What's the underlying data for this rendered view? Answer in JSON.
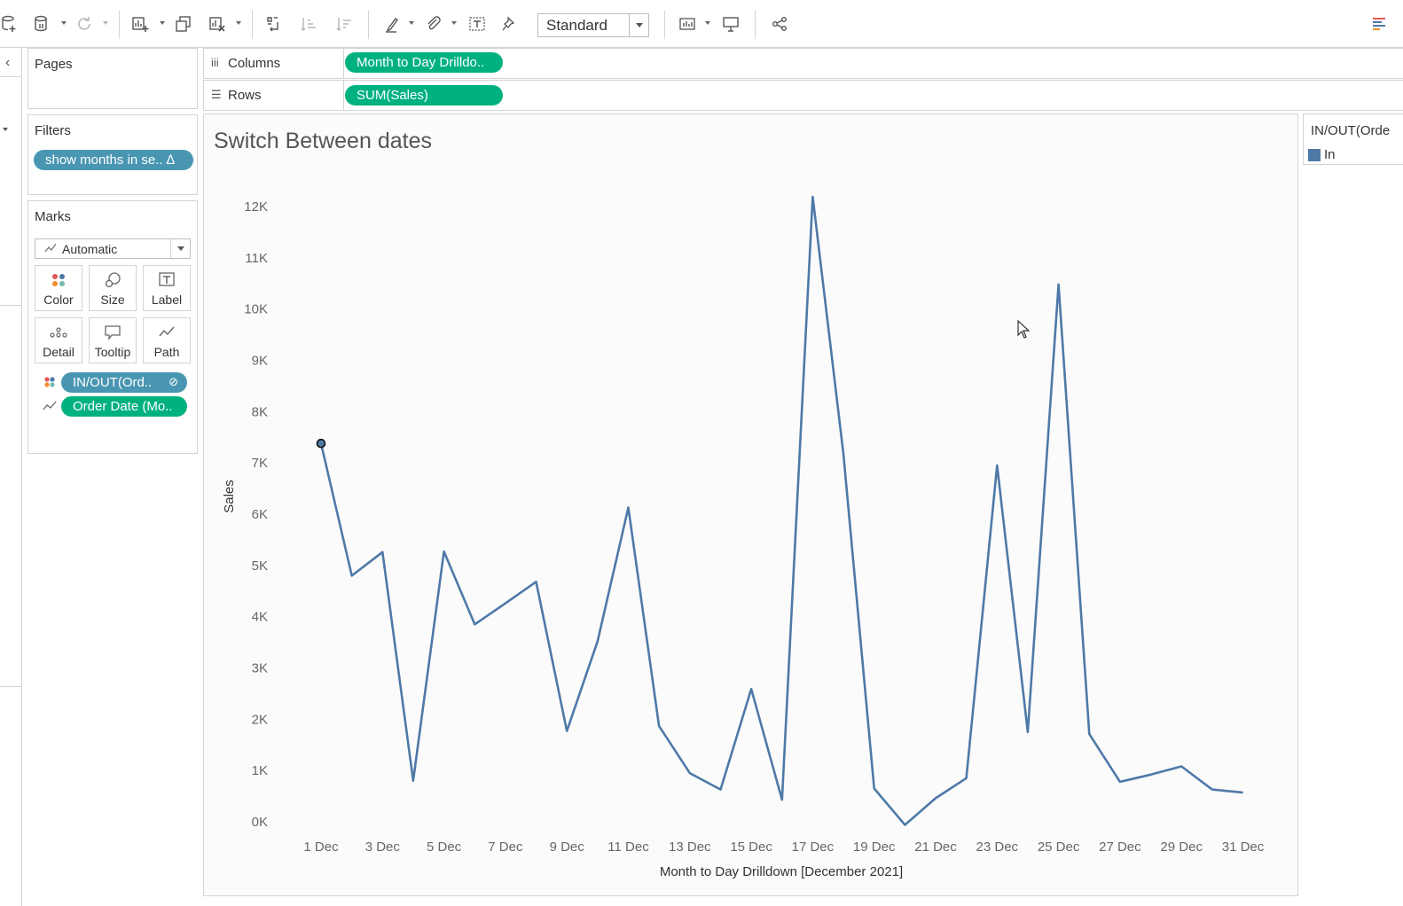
{
  "toolbar": {
    "view_size_select": "Standard"
  },
  "cards": {
    "pages": {
      "title": "Pages"
    },
    "filters": {
      "title": "Filters",
      "pills": [
        {
          "label": "show months in se.. ∆"
        }
      ]
    },
    "marks": {
      "title": "Marks",
      "mark_type": "Automatic",
      "buttons": [
        {
          "label": "Color",
          "icon": "color-dots-icon"
        },
        {
          "label": "Size",
          "icon": "size-icon"
        },
        {
          "label": "Label",
          "icon": "label-icon"
        },
        {
          "label": "Detail",
          "icon": "detail-icon"
        },
        {
          "label": "Tooltip",
          "icon": "tooltip-icon"
        },
        {
          "label": "Path",
          "icon": "path-icon"
        }
      ],
      "pills": [
        {
          "label": "IN/OUT(Ord..",
          "icon": "color-dots-icon"
        },
        {
          "label": "Order Date (Mo..",
          "icon": "path-icon"
        }
      ]
    }
  },
  "shelves": {
    "columns": {
      "label": "Columns",
      "pill": "Month to Day Drilldo.."
    },
    "rows": {
      "label": "Rows",
      "pill": "SUM(Sales)"
    }
  },
  "legend": {
    "title": "IN/OUT(Orde",
    "items": [
      {
        "label": "In",
        "color": "#4e79a7"
      }
    ]
  },
  "chart_data": {
    "type": "line",
    "title": "Switch Between dates",
    "xlabel": "Month to Day Drilldown [December 2021]",
    "ylabel": "Sales",
    "x_tick_labels": [
      "1 Dec",
      "3 Dec",
      "5 Dec",
      "7 Dec",
      "9 Dec",
      "11 Dec",
      "13 Dec",
      "15 Dec",
      "17 Dec",
      "19 Dec",
      "21 Dec",
      "23 Dec",
      "25 Dec",
      "27 Dec",
      "29 Dec",
      "31 Dec"
    ],
    "y_tick_labels": [
      "0K",
      "1K",
      "2K",
      "3K",
      "4K",
      "5K",
      "6K",
      "7K",
      "8K",
      "9K",
      "10K",
      "11K",
      "12K"
    ],
    "ylim": [
      0,
      12000
    ],
    "grid": false,
    "color": "#4e79a7",
    "series": [
      {
        "name": "In",
        "x": [
          1,
          2,
          3,
          4,
          5,
          6,
          7,
          8,
          9,
          10,
          11,
          12,
          13,
          14,
          15,
          16,
          17,
          18,
          19,
          20,
          21,
          22,
          23,
          24,
          25,
          26,
          27,
          28,
          29,
          30,
          31
        ],
        "values": [
          7380,
          4800,
          5260,
          800,
          5270,
          3850,
          4260,
          4680,
          1770,
          3520,
          6130,
          1870,
          950,
          630,
          2590,
          430,
          12190,
          7180,
          650,
          -60,
          460,
          850,
          6950,
          1750,
          10480,
          1710,
          780,
          920,
          1080,
          630,
          570
        ]
      }
    ]
  }
}
